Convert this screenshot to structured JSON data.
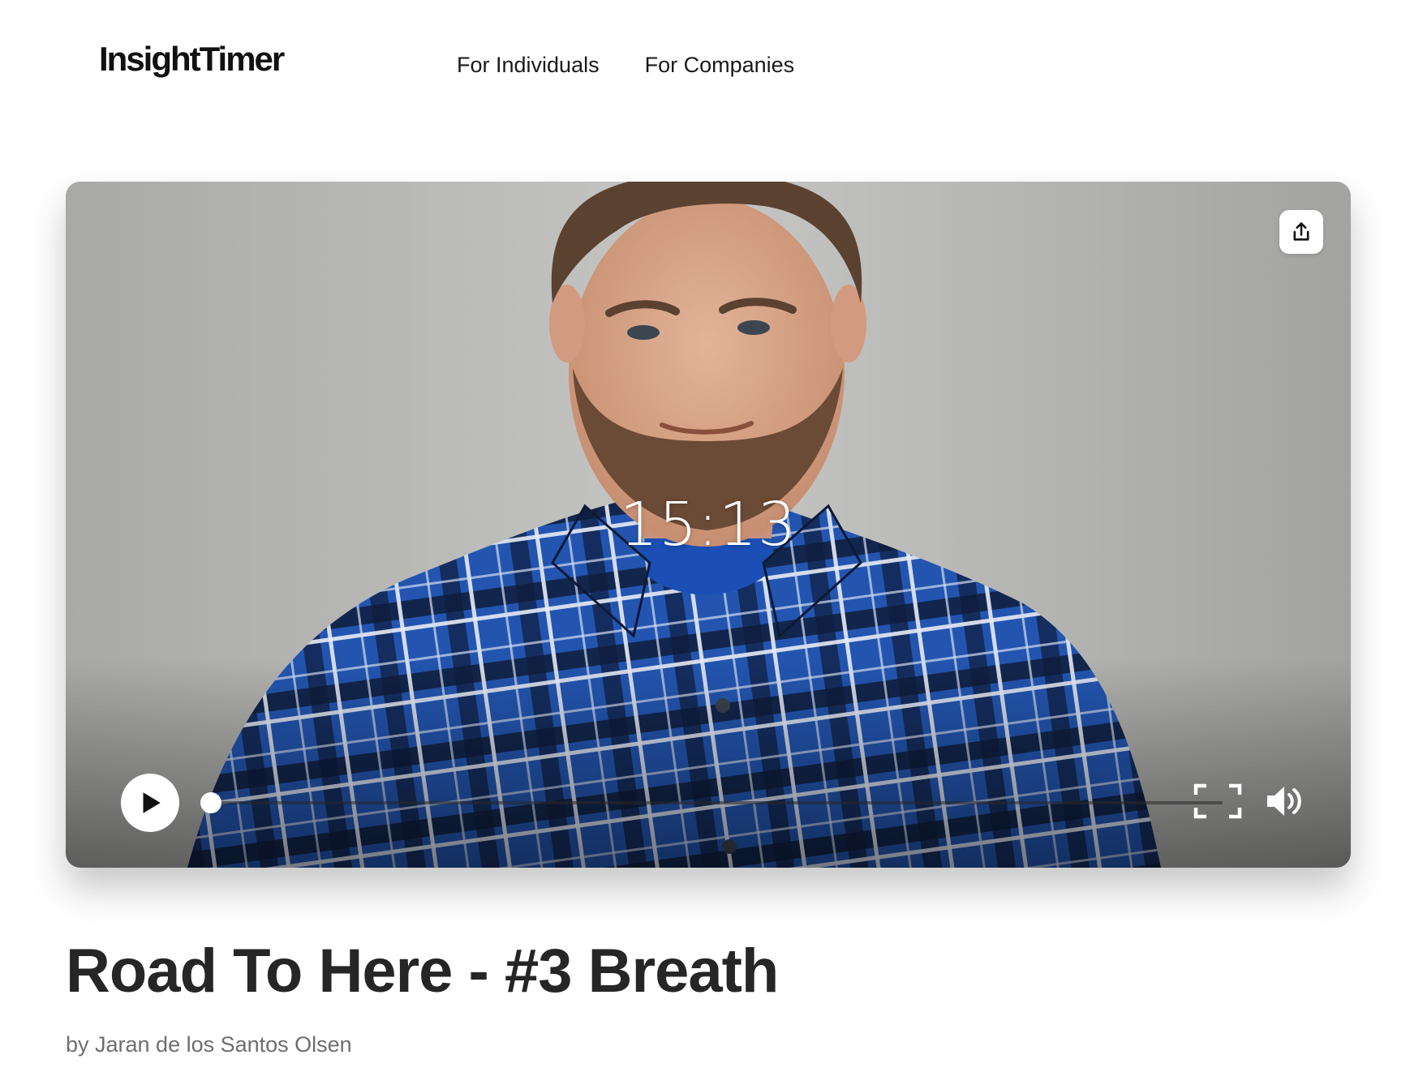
{
  "header": {
    "logo_text": "InsightTimer",
    "nav": [
      {
        "label": "For Individuals"
      },
      {
        "label": "For Companies"
      }
    ]
  },
  "player": {
    "timer": "15:13",
    "progress": 0.01,
    "share_icon": "share-upload-icon",
    "play_icon": "play-icon",
    "fullscreen_icon": "fullscreen-icon",
    "volume_icon": "volume-icon"
  },
  "track": {
    "title": "Road To Here - #3 Breath",
    "author": "by Jaran de los Santos Olsen"
  },
  "colors": {
    "background": "#ffffff",
    "title_text": "#262626",
    "author_text": "#6e6e6e",
    "shirt_blue": "#1f4fa8",
    "wall_grey": "#b9b9b8"
  }
}
